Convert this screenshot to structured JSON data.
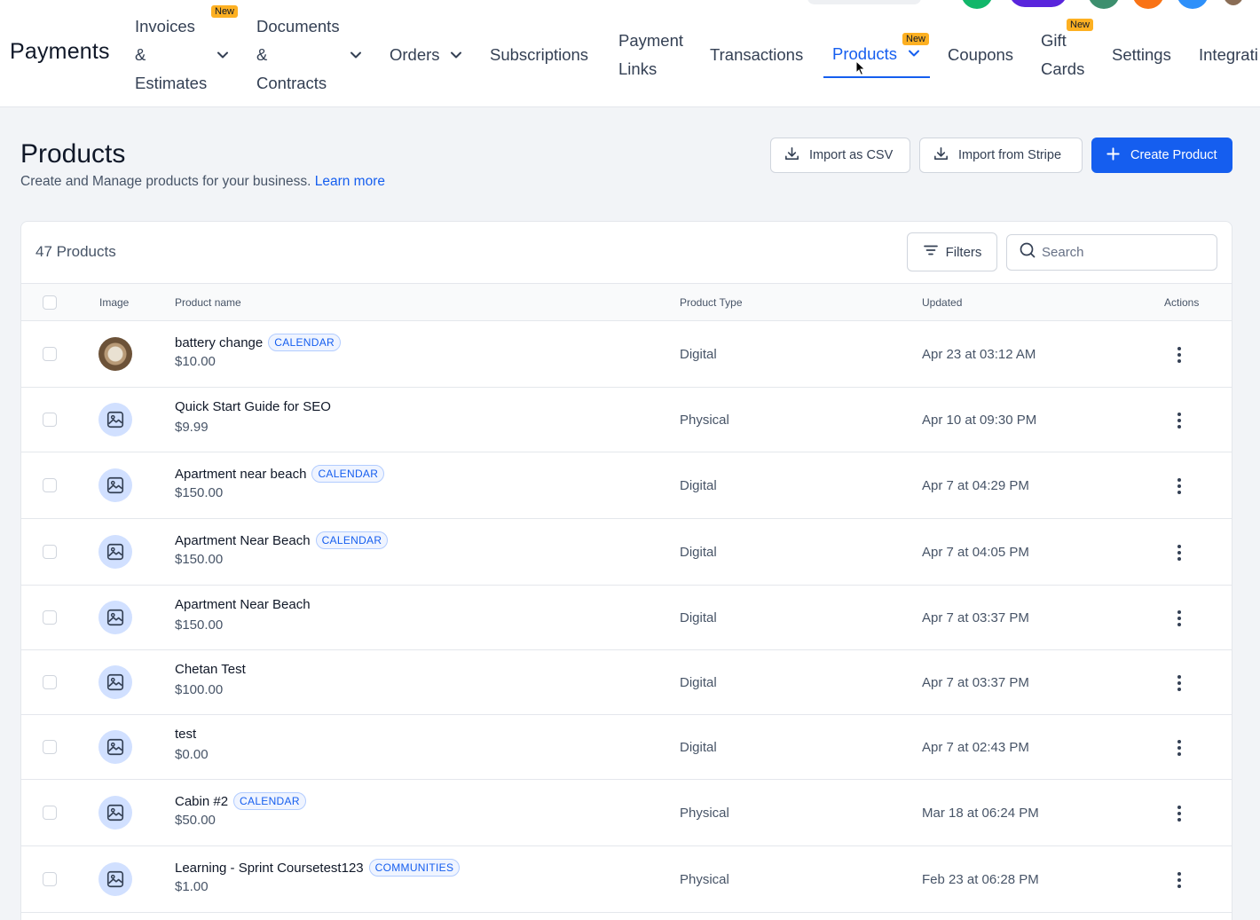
{
  "brand": "Payments",
  "nav": {
    "invoices": [
      "Invoices",
      "&",
      "Estimates"
    ],
    "documents": [
      "Documents",
      "&",
      "Contracts"
    ],
    "orders": "Orders",
    "subscriptions": "Subscriptions",
    "payment_links": [
      "Payment",
      "Links"
    ],
    "transactions": "Transactions",
    "products": "Products",
    "coupons": "Coupons",
    "gift_cards": [
      "Gift",
      "Cards"
    ],
    "settings": "Settings",
    "integrations": "Integrati",
    "new_badge": "New"
  },
  "header": {
    "title": "Products",
    "subtitle": "Create and Manage products for your business.",
    "learn_more": "Learn more",
    "import_csv": "Import as CSV",
    "import_stripe": "Import from Stripe",
    "create": "Create Product"
  },
  "table": {
    "count": "47 Products",
    "filters": "Filters",
    "search_placeholder": "Search",
    "columns": {
      "image": "Image",
      "name": "Product name",
      "type": "Product Type",
      "updated": "Updated",
      "actions": "Actions"
    },
    "rows": [
      {
        "name": "battery change",
        "tag": "CALENDAR",
        "price": "$10.00",
        "type": "Digital",
        "updated": "Apr 23 at 03:12 AM",
        "photo": true
      },
      {
        "name": "Quick Start Guide for SEO",
        "tag": "",
        "price": "$9.99",
        "type": "Physical",
        "updated": "Apr 10 at 09:30 PM"
      },
      {
        "name": "Apartment near beach",
        "tag": "CALENDAR",
        "price": "$150.00",
        "type": "Digital",
        "updated": "Apr 7 at 04:29 PM"
      },
      {
        "name": "Apartment Near Beach",
        "tag": "CALENDAR",
        "price": "$150.00",
        "type": "Digital",
        "updated": "Apr 7 at 04:05 PM"
      },
      {
        "name": "Apartment Near Beach",
        "tag": "",
        "price": "$150.00",
        "type": "Digital",
        "updated": "Apr 7 at 03:37 PM"
      },
      {
        "name": "Chetan Test",
        "tag": "",
        "price": "$100.00",
        "type": "Digital",
        "updated": "Apr 7 at 03:37 PM"
      },
      {
        "name": "test",
        "tag": "",
        "price": "$0.00",
        "type": "Digital",
        "updated": "Apr 7 at 02:43 PM"
      },
      {
        "name": "Cabin #2",
        "tag": "CALENDAR",
        "price": "$50.00",
        "type": "Physical",
        "updated": "Mar 18 at 06:24 PM"
      },
      {
        "name": "Learning - Sprint Coursetest123",
        "tag": "COMMUNITIES",
        "price": "$1.00",
        "type": "Physical",
        "updated": "Feb 23 at 06:28 PM"
      }
    ]
  },
  "colors": {
    "accent": "#155eef",
    "badge": "#fdb022"
  }
}
